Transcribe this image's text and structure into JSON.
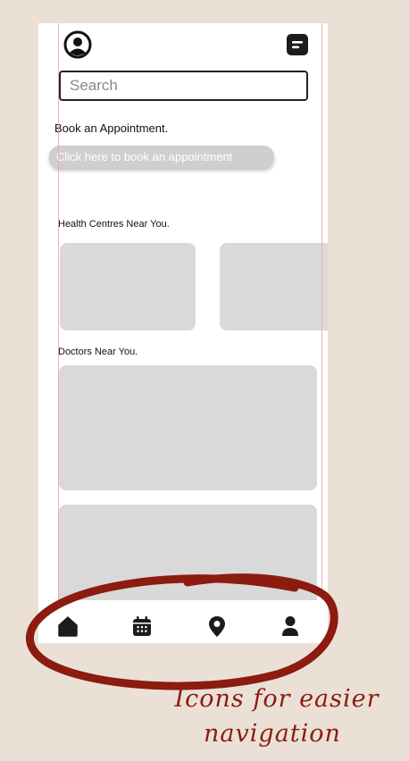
{
  "header": {
    "profile_icon": "user-circle-icon",
    "menu_icon": "note-menu-icon"
  },
  "search": {
    "placeholder": "Search"
  },
  "booking": {
    "title": "Book an Appointment.",
    "button_label": "Click here to book an appointment"
  },
  "health_centres": {
    "title": "Health Centres Near You."
  },
  "doctors": {
    "title": "Doctors Near You."
  },
  "bottom_nav": {
    "items": [
      {
        "icon": "home-icon"
      },
      {
        "icon": "calendar-icon"
      },
      {
        "icon": "location-pin-icon"
      },
      {
        "icon": "person-icon"
      }
    ]
  },
  "annotation": {
    "line1": "Icons for easier",
    "line2": "navigation",
    "color": "#8c1b10"
  },
  "colors": {
    "background": "#ebe0d6",
    "card": "#d9d9d9",
    "guide": "#f2a7a7"
  }
}
